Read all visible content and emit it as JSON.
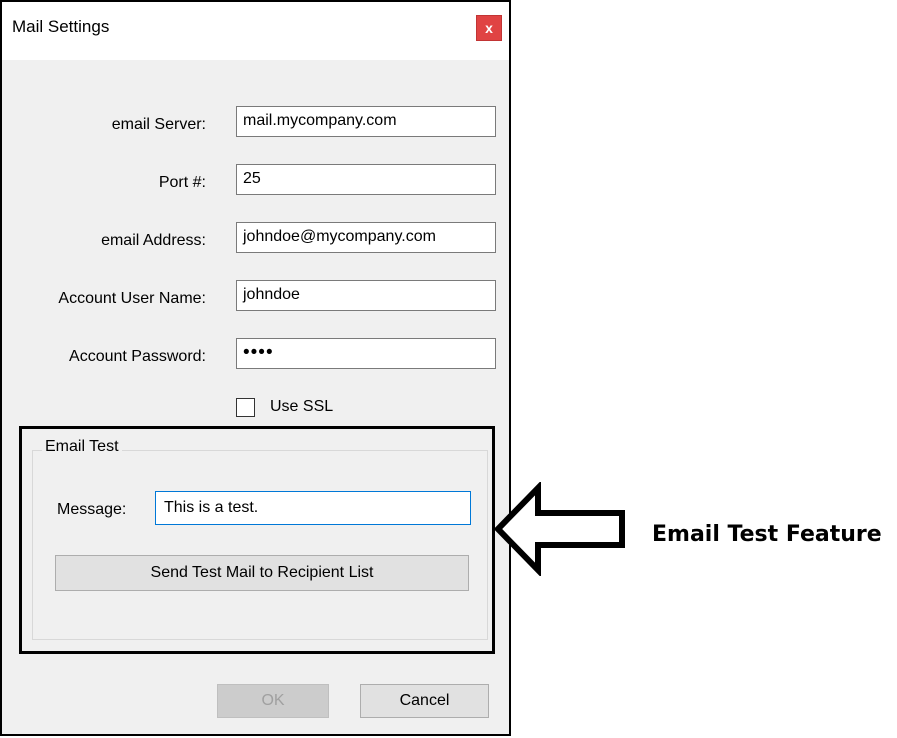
{
  "window": {
    "title": "Mail Settings",
    "close_label": "x"
  },
  "form": {
    "server_label": "email Server:",
    "server_value": "mail.mycompany.com",
    "port_label": "Port #:",
    "port_value": "25",
    "address_label": "email Address:",
    "address_value": "johndoe@mycompany.com",
    "username_label": "Account User Name:",
    "username_value": "johndoe",
    "password_label": "Account Password:",
    "password_value": "••••",
    "ssl_label": "Use SSL",
    "ssl_checked": false
  },
  "email_test": {
    "group_title": "Email Test",
    "message_label": "Message:",
    "message_value": "This is a test.",
    "send_button": "Send Test Mail to Recipient List"
  },
  "footer": {
    "ok_label": "OK",
    "cancel_label": "Cancel"
  },
  "annotation": {
    "text": "Email Test Feature"
  },
  "colors": {
    "close_button": "#e04343",
    "dialog_bg": "#f0f0f0",
    "focus_border": "#0078d7"
  }
}
